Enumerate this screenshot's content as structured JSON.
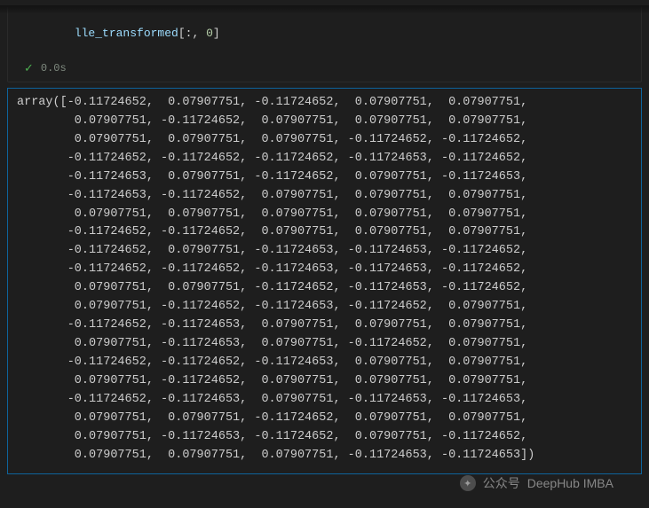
{
  "cell": {
    "code_variable": "lle_transformed",
    "code_slice_inner": ":, ",
    "code_index": "0",
    "status_time": "0.0s"
  },
  "output": {
    "prefix": "array([",
    "suffix": "])",
    "rows": [
      [
        -0.11724652,
        0.07907751,
        -0.11724652,
        0.07907751,
        0.07907751
      ],
      [
        0.07907751,
        -0.11724652,
        0.07907751,
        0.07907751,
        0.07907751
      ],
      [
        0.07907751,
        0.07907751,
        0.07907751,
        -0.11724652,
        -0.11724652
      ],
      [
        -0.11724652,
        -0.11724652,
        -0.11724652,
        -0.11724653,
        -0.11724652
      ],
      [
        -0.11724653,
        0.07907751,
        -0.11724652,
        0.07907751,
        -0.11724653
      ],
      [
        -0.11724653,
        -0.11724652,
        0.07907751,
        0.07907751,
        0.07907751
      ],
      [
        0.07907751,
        0.07907751,
        0.07907751,
        0.07907751,
        0.07907751
      ],
      [
        -0.11724652,
        -0.11724652,
        0.07907751,
        0.07907751,
        0.07907751
      ],
      [
        -0.11724652,
        0.07907751,
        -0.11724653,
        -0.11724653,
        -0.11724652
      ],
      [
        -0.11724652,
        -0.11724652,
        -0.11724653,
        -0.11724653,
        -0.11724652
      ],
      [
        0.07907751,
        0.07907751,
        -0.11724652,
        -0.11724653,
        -0.11724652
      ],
      [
        0.07907751,
        -0.11724652,
        -0.11724653,
        -0.11724652,
        0.07907751
      ],
      [
        -0.11724652,
        -0.11724653,
        0.07907751,
        0.07907751,
        0.07907751
      ],
      [
        0.07907751,
        -0.11724653,
        0.07907751,
        -0.11724652,
        0.07907751
      ],
      [
        -0.11724652,
        -0.11724652,
        -0.11724653,
        0.07907751,
        0.07907751
      ],
      [
        0.07907751,
        -0.11724652,
        0.07907751,
        0.07907751,
        0.07907751
      ],
      [
        -0.11724652,
        -0.11724653,
        0.07907751,
        -0.11724653,
        -0.11724653
      ],
      [
        0.07907751,
        0.07907751,
        -0.11724652,
        0.07907751,
        0.07907751
      ],
      [
        0.07907751,
        -0.11724653,
        -0.11724652,
        0.07907751,
        -0.11724652
      ],
      [
        0.07907751,
        0.07907751,
        0.07907751,
        -0.11724653,
        -0.11724653
      ]
    ]
  },
  "watermark": {
    "prefix": "公众号",
    "name": "DeepHub IMBA"
  }
}
